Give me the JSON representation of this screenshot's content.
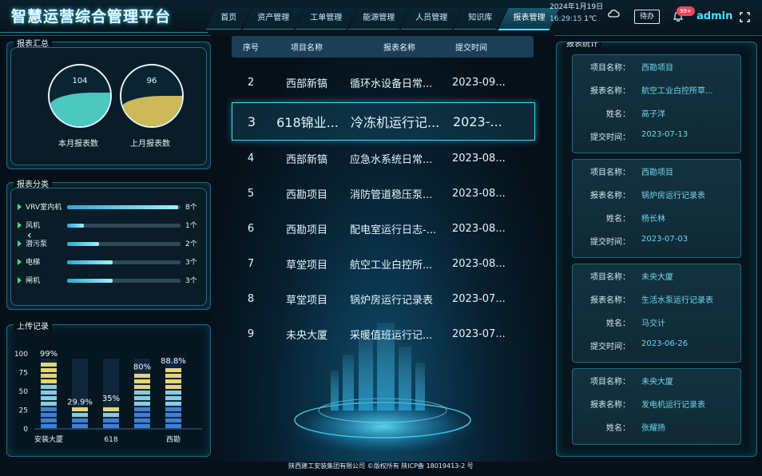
{
  "header": {
    "title": "智慧运营综合管理平台",
    "nav": [
      {
        "label": "首页",
        "active": false
      },
      {
        "label": "资产管理",
        "active": false
      },
      {
        "label": "工单管理",
        "active": false
      },
      {
        "label": "能源管理",
        "active": false
      },
      {
        "label": "人员管理",
        "active": false
      },
      {
        "label": "知识库",
        "active": false
      },
      {
        "label": "报表管理",
        "active": true
      }
    ],
    "date": "2024年1月19日",
    "time": "16:29:15",
    "temperature": "1℃",
    "weather_icon": "cloud-icon",
    "todo_label": "待办",
    "notification_badge": "99+",
    "username": "admin"
  },
  "summary": {
    "title": "报表汇总",
    "gauges": [
      {
        "value": "104",
        "label": "本月报表数",
        "color": "#4fd1c5",
        "level": 0.55
      },
      {
        "value": "96",
        "label": "上月报表数",
        "color": "#d6c25a",
        "level": 0.5
      }
    ]
  },
  "category": {
    "title": "报表分类",
    "items": [
      {
        "name": "VRV室内机",
        "count": "8个",
        "ratio": 0.98
      },
      {
        "name": "风机",
        "count": "1个",
        "ratio": 0.15
      },
      {
        "name": "潜污泵",
        "count": "2个",
        "ratio": 0.28
      },
      {
        "name": "电梯",
        "count": "3个",
        "ratio": 0.4
      },
      {
        "name": "闸机",
        "count": "3个",
        "ratio": 0.4
      }
    ]
  },
  "upload": {
    "title": "上传记录",
    "chart_data": {
      "type": "bar",
      "categories": [
        "安装大厦",
        "",
        "618",
        "",
        "西勘"
      ],
      "values": [
        99,
        29.9,
        35,
        80,
        88.8
      ],
      "data_labels": [
        "99%",
        "29.9%",
        "35%",
        "80%",
        "88.8%"
      ],
      "yticks": [
        "100",
        "75",
        "50",
        "25",
        "0"
      ],
      "ylim": [
        0,
        100
      ]
    }
  },
  "table": {
    "headers": [
      "序号",
      "项目名称",
      "报表名称",
      "提交时间"
    ],
    "rows": [
      {
        "no": "2",
        "project": "西部新镐",
        "report": "循环水设备日常...",
        "time": "2023-09...",
        "selected": false
      },
      {
        "no": "3",
        "project": "618锦业...",
        "report": "冷冻机运行记...",
        "time": "2023-...",
        "selected": true
      },
      {
        "no": "4",
        "project": "西部新镐",
        "report": "应急水系统日常...",
        "time": "2023-08...",
        "selected": false
      },
      {
        "no": "5",
        "project": "西勘项目",
        "report": "消防管道稳压泵...",
        "time": "2023-08...",
        "selected": false
      },
      {
        "no": "6",
        "project": "西勘项目",
        "report": "配电室运行日志-...",
        "time": "2023-08...",
        "selected": false
      },
      {
        "no": "7",
        "project": "草堂项目",
        "report": "航空工业白控所...",
        "time": "2023-08...",
        "selected": false
      },
      {
        "no": "8",
        "project": "草堂项目",
        "report": "锅炉房运行记录表",
        "time": "2023-07...",
        "selected": false
      },
      {
        "no": "9",
        "project": "未央大厦",
        "report": "采暖值班运行记...",
        "time": "2023-07...",
        "selected": false
      }
    ]
  },
  "stats": {
    "title": "报表统计",
    "labels": {
      "project": "项目名称：",
      "report": "报表名称：",
      "name": "姓名：",
      "time": "提交时间："
    },
    "cards": [
      {
        "project": "西勘项目",
        "report": "航空工业白控所草...",
        "name": "高子洋",
        "time": "2023-07-13"
      },
      {
        "project": "西勘项目",
        "report": "锅炉房运行记录表",
        "name": "杨长林",
        "time": "2023-07-03"
      },
      {
        "project": "未央大厦",
        "report": "生活水泵运行记录表",
        "name": "马交计",
        "time": "2023-06-26"
      },
      {
        "project": "未央大厦",
        "report": "发电机运行记录表",
        "name": "张耀扬",
        "time": ""
      }
    ]
  },
  "footer": {
    "text": "陕西建工安装集团有限公司 ©版权所有 陕ICP备 18019413-2 号"
  },
  "colors": {
    "accent": "#3ad8ff",
    "teal": "#4fd1c5",
    "gold": "#d6c25a",
    "value_text": "#6fd8ee"
  }
}
